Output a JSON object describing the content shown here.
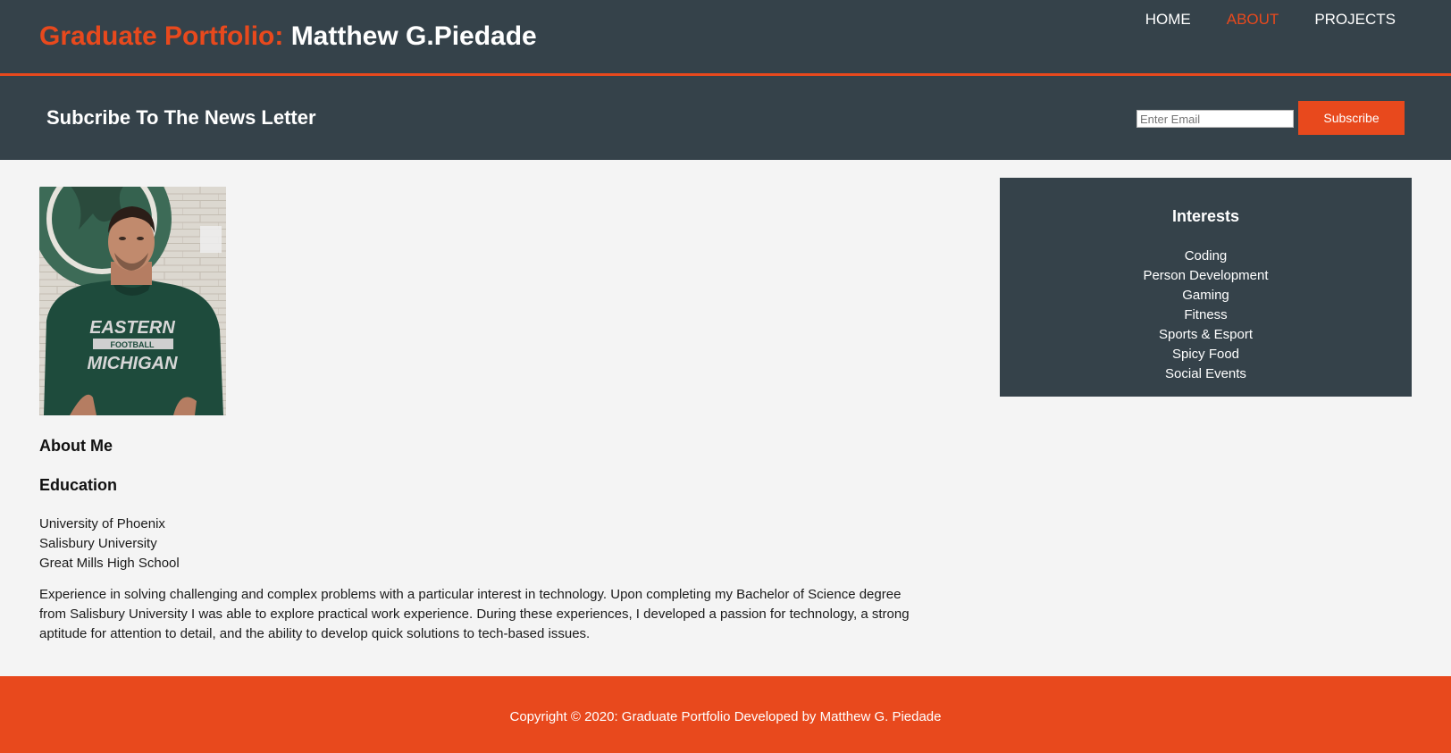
{
  "header": {
    "title_accent": "Graduate Portfolio:",
    "title_name": "Matthew G.Piedade",
    "nav": [
      {
        "label": "HOME",
        "current": false
      },
      {
        "label": "ABOUT",
        "current": true
      },
      {
        "label": "PROJECTS",
        "current": false
      }
    ]
  },
  "newsletter": {
    "heading": "Subcribe To The News Letter",
    "email_placeholder": "Enter Email",
    "subscribe_label": "Subscribe"
  },
  "main": {
    "about_heading": "About Me",
    "education_heading": "Education",
    "education": [
      "University of Phoenix",
      "Salisbury University",
      "Great Mills High School"
    ],
    "bio": "Experience in solving challenging and complex problems with a particular interest in technology. Upon completing my Bachelor of Science degree from Salisbury University I was able to explore practical work experience. During these experiences, I developed a passion for technology, a strong aptitude for attention to detail, and the ability to develop quick solutions to tech-based issues."
  },
  "sidebar": {
    "heading": "Interests",
    "items": [
      "Coding",
      "Person Development",
      "Gaming",
      "Fitness",
      "Sports & Esport",
      "Spicy Food",
      "Social Events"
    ]
  },
  "photo": {
    "shirt_line1": "EASTERN",
    "shirt_line2": "FOOTBALL",
    "shirt_line3": "MICHIGAN"
  },
  "footer": {
    "copyright": "Copyright © 2020: Graduate Portfolio Developed by Matthew G. Piedade"
  },
  "colors": {
    "brand_dark": "#35424a",
    "accent": "#e8491d",
    "page_bg": "#f4f4f4"
  }
}
